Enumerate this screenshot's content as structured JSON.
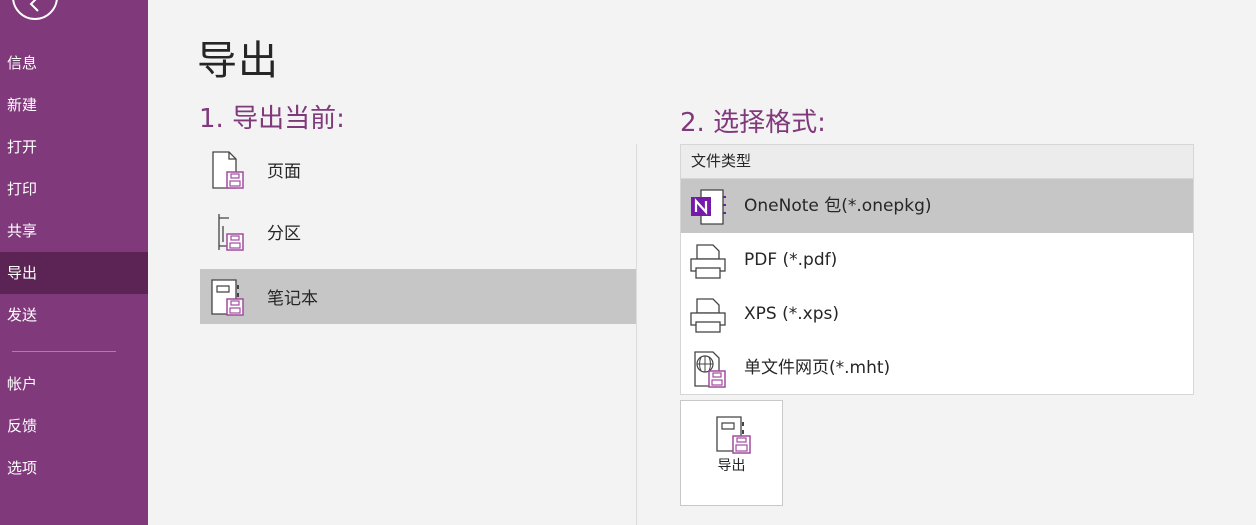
{
  "colors": {
    "sidebar": "#80397b",
    "sidebar_active": "#5b2454",
    "accent": "#80397b",
    "selection": "#c6c6c6"
  },
  "sidebar": {
    "back_icon": "back-arrow-icon",
    "items": [
      {
        "label": "信息",
        "active": false
      },
      {
        "label": "新建",
        "active": false
      },
      {
        "label": "打开",
        "active": false
      },
      {
        "label": "打印",
        "active": false
      },
      {
        "label": "共享",
        "active": false
      },
      {
        "label": "导出",
        "active": true
      },
      {
        "label": "发送",
        "active": false
      },
      {
        "label": "帐户",
        "active": false
      },
      {
        "label": "反馈",
        "active": false
      },
      {
        "label": "选项",
        "active": false
      }
    ]
  },
  "page": {
    "title": "导出",
    "section1_heading": "1. 导出当前:",
    "section2_heading": "2. 选择格式:"
  },
  "scope_options": [
    {
      "label": "页面",
      "icon": "page-export-icon",
      "selected": false
    },
    {
      "label": "分区",
      "icon": "section-export-icon",
      "selected": false
    },
    {
      "label": "笔记本",
      "icon": "notebook-export-icon",
      "selected": true
    }
  ],
  "formats": {
    "header": "文件类型",
    "items": [
      {
        "label": "OneNote 包(*.onepkg)",
        "icon": "onenote-package-icon",
        "selected": true
      },
      {
        "label": "PDF (*.pdf)",
        "icon": "pdf-printer-icon",
        "selected": false
      },
      {
        "label": "XPS (*.xps)",
        "icon": "xps-printer-icon",
        "selected": false
      },
      {
        "label": "单文件网页(*.mht)",
        "icon": "web-page-icon",
        "selected": false
      }
    ]
  },
  "export_button": {
    "label": "导出",
    "icon": "export-notebook-icon"
  }
}
